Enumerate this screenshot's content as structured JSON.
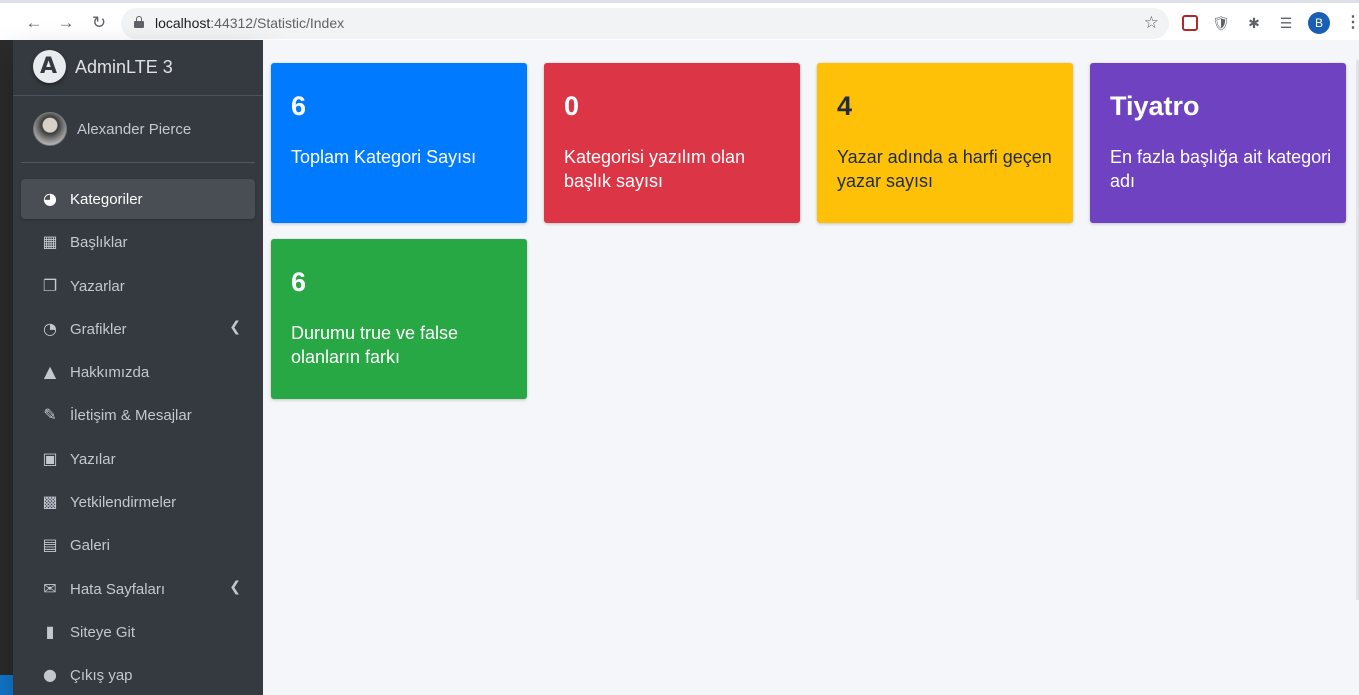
{
  "browser": {
    "url_host": "localhost",
    "url_path": ":44312/Statistic/Index",
    "profile_initial": "B"
  },
  "brand": {
    "logo_letter": "A",
    "name": "AdminLTE 3"
  },
  "user": {
    "name": "Alexander Pierce"
  },
  "sidebar": {
    "items": [
      {
        "label": "Kategoriler",
        "icon": "tachometer-icon",
        "active": true
      },
      {
        "label": "Başlıklar",
        "icon": "th-grid-icon"
      },
      {
        "label": "Yazarlar",
        "icon": "copy-icon"
      },
      {
        "label": "Grafikler",
        "icon": "chart-pie-icon",
        "has_arrow": true
      },
      {
        "label": "Hakkımızda",
        "icon": "tree-icon"
      },
      {
        "label": "İletişim & Mesajlar",
        "icon": "edit-icon"
      },
      {
        "label": "Yazılar",
        "icon": "table-icon"
      },
      {
        "label": "Yetkilendirmeler",
        "icon": "calendar-icon"
      },
      {
        "label": "Galeri",
        "icon": "image-icon"
      },
      {
        "label": "Hata Sayfaları",
        "icon": "envelope-icon",
        "has_arrow": true
      },
      {
        "label": "Siteye Git",
        "icon": "book-icon"
      },
      {
        "label": "Çıkış yap",
        "icon": "apple-icon"
      }
    ]
  },
  "boxes": [
    {
      "value": "6",
      "text": "Toplam Kategori Sayısı",
      "color": "#007bff"
    },
    {
      "value": "0",
      "text": "Kategorisi yazılım olan başlık sayısı",
      "color": "#dc3545"
    },
    {
      "value": "4",
      "text": "Yazar adında a harfi geçen yazar sayısı",
      "color": "#ffc107"
    },
    {
      "value": "Tiyatro",
      "text": "En fazla başlığa ait kategori adı",
      "color": "#6f42c1"
    },
    {
      "value": "6",
      "text": "Durumu true ve false olanların farkı",
      "color": "#28a745"
    }
  ]
}
